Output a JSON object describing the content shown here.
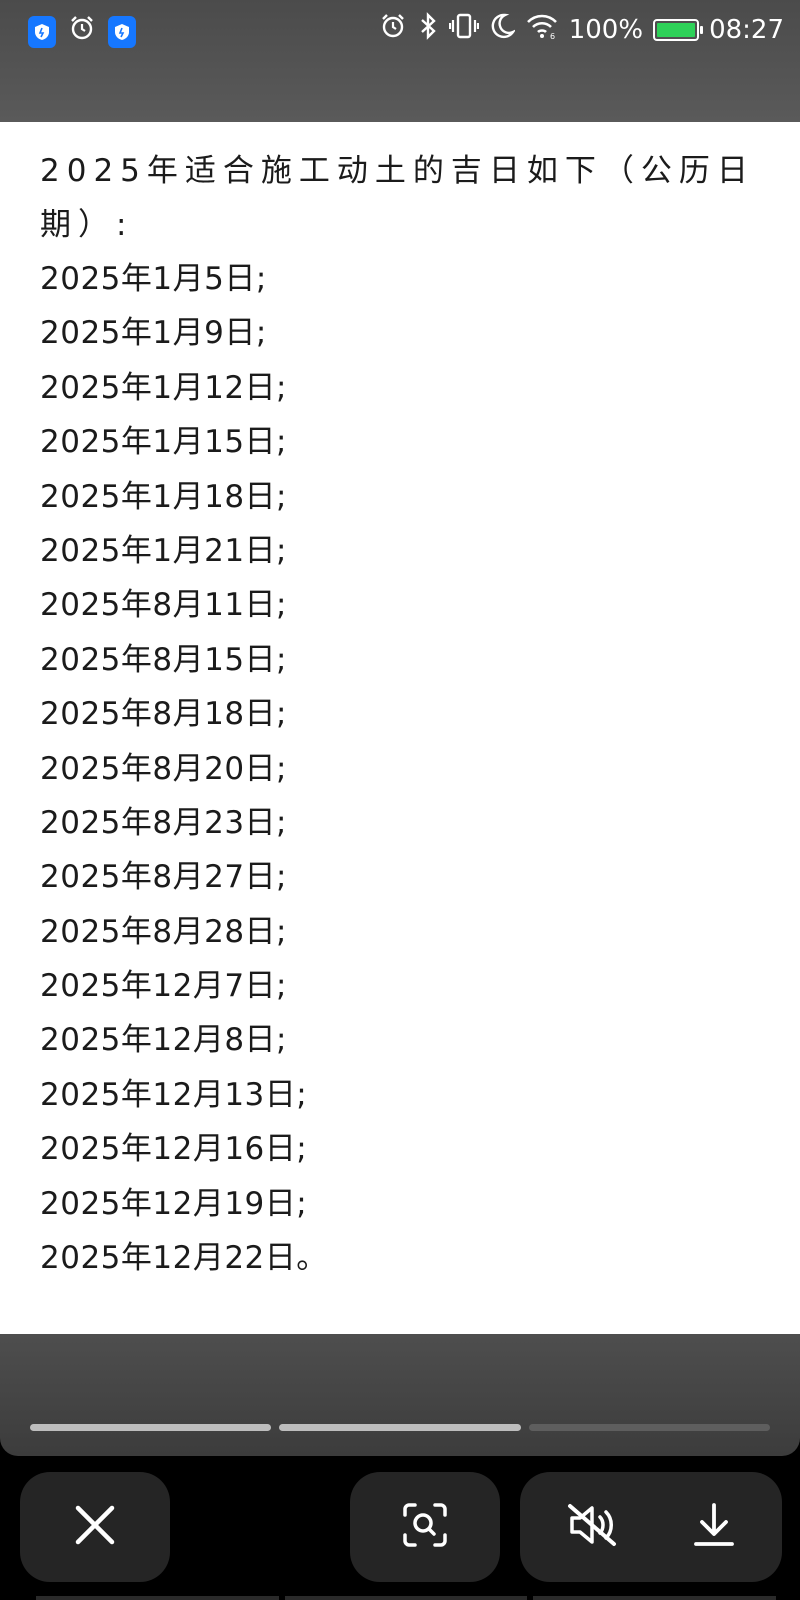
{
  "status_bar": {
    "battery": "100%",
    "battery_level": 1.0,
    "time": "08:27",
    "battery_color": "#2ed158",
    "left_icons": [
      "shield-app-icon",
      "alarm-icon",
      "shield-app-icon"
    ],
    "right_icons": [
      "alarm-icon",
      "bluetooth-icon",
      "vibrate-icon",
      "moon-icon",
      "wifi-icon",
      "battery-icon"
    ]
  },
  "content": {
    "title": "2025年适合施工动土的吉日如下（公历日期）:",
    "dates": [
      "2025年1月5日;",
      "2025年1月9日;",
      "2025年1月12日;",
      "2025年1月15日;",
      "2025年1月18日;",
      "2025年1月21日;",
      "2025年8月11日;",
      "2025年8月15日;",
      "2025年8月18日;",
      "2025年8月20日;",
      "2025年8月23日;",
      "2025年8月27日;",
      "2025年8月28日;",
      "2025年12月7日;",
      "2025年12月8日;",
      "2025年12月13日;",
      "2025年12月16日;",
      "2025年12月19日;",
      "2025年12月22日。"
    ]
  },
  "story_progress": [
    1.0,
    1.0,
    0.0
  ],
  "toolbar": {
    "buttons": [
      "close-icon",
      "image-search-icon",
      "mute-icon",
      "download-icon"
    ]
  }
}
